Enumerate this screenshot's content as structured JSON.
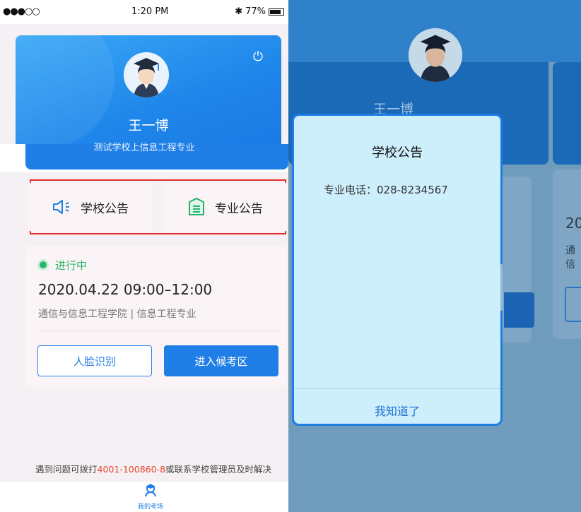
{
  "status_bar": {
    "signal": "●●●○○",
    "time": "1:20 PM",
    "bluetooth": "✱",
    "battery": "77%"
  },
  "profile": {
    "name": "王一博",
    "school": "测试学校上信息工程专业",
    "power_icon": "power-icon"
  },
  "notices": {
    "school_label": "学校公告",
    "major_label": "专业公告"
  },
  "exam": {
    "status": "进行中",
    "time": "2020.04.22  09:00–12:00",
    "sub": "通信与信息工程学院 | 信息工程专业",
    "face_button": "人脸识别",
    "enter_button": "进入候考区"
  },
  "help": {
    "prefix": "遇到问题可拨打",
    "phone": "4001-100860-8",
    "suffix": "或联系学校管理员及时解决"
  },
  "tabbar": {
    "label": "我的考场"
  },
  "right_bg": {
    "name": "王一博",
    "peek_year": "20",
    "peek_text": "通信"
  },
  "modal": {
    "title": "学校公告",
    "body": "专业电话：028-8234567",
    "ok": "我知道了"
  },
  "colors": {
    "primary": "#1f7fe6",
    "success": "#29b66b",
    "highlight_border": "#e32b2b",
    "phone_red": "#e5482f"
  }
}
